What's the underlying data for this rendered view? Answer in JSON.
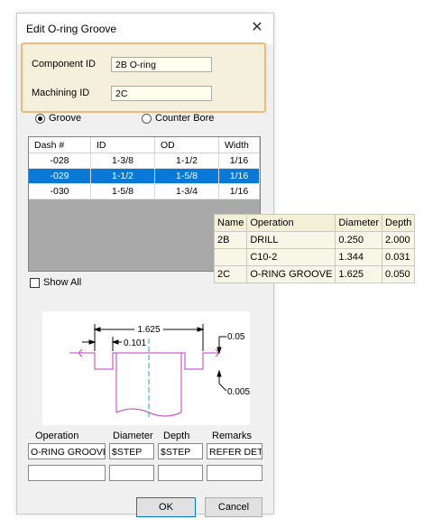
{
  "dialog": {
    "title": "Edit O-ring Groove",
    "close_glyph": "✕"
  },
  "ids": {
    "component_label": "Component ID",
    "component_value": "2B O-ring",
    "machining_label": "Machining ID",
    "machining_value": "2C"
  },
  "radios": {
    "groove_label": "Groove",
    "counter_bore_label": "Counter Bore",
    "selected": "groove"
  },
  "dash_table": {
    "headers": [
      "Dash #",
      "ID",
      "OD",
      "Width"
    ],
    "rows": [
      [
        "-028",
        "1-3/8",
        "1-1/2",
        "1/16"
      ],
      [
        "-029",
        "1-1/2",
        "1-5/8",
        "1/16"
      ],
      [
        "-030",
        "1-5/8",
        "1-3/4",
        "1/16"
      ]
    ],
    "selected_row": 1
  },
  "show_all_label": "Show All",
  "diagram_labels": {
    "overall_width": "1.625",
    "offset": "0.101",
    "depth": "0.05",
    "radius": "0.005"
  },
  "fields": {
    "operation_label": "Operation",
    "diameter_label": "Diameter",
    "depth_label": "Depth",
    "remarks_label": "Remarks",
    "operation_value": "O-RING GROOVE",
    "diameter_value": "$STEP",
    "depth_value": "$STEP",
    "remarks_value": "REFER DET"
  },
  "buttons": {
    "ok": "OK",
    "cancel": "Cancel"
  },
  "operations_table": {
    "headers": [
      "Name",
      "Operation",
      "Diameter",
      "Depth"
    ],
    "rows": [
      [
        "2B",
        "DRILL",
        "0.250",
        "2.000"
      ],
      [
        "",
        "C10-2",
        "1.344",
        "0.031"
      ],
      [
        "2C",
        "O-RING GROOVE",
        "1.625",
        "0.050"
      ]
    ]
  },
  "colors": {
    "highlight_border": "#f1b978",
    "selection": "#0a78d7",
    "id_panel": "#f5f0dc"
  }
}
